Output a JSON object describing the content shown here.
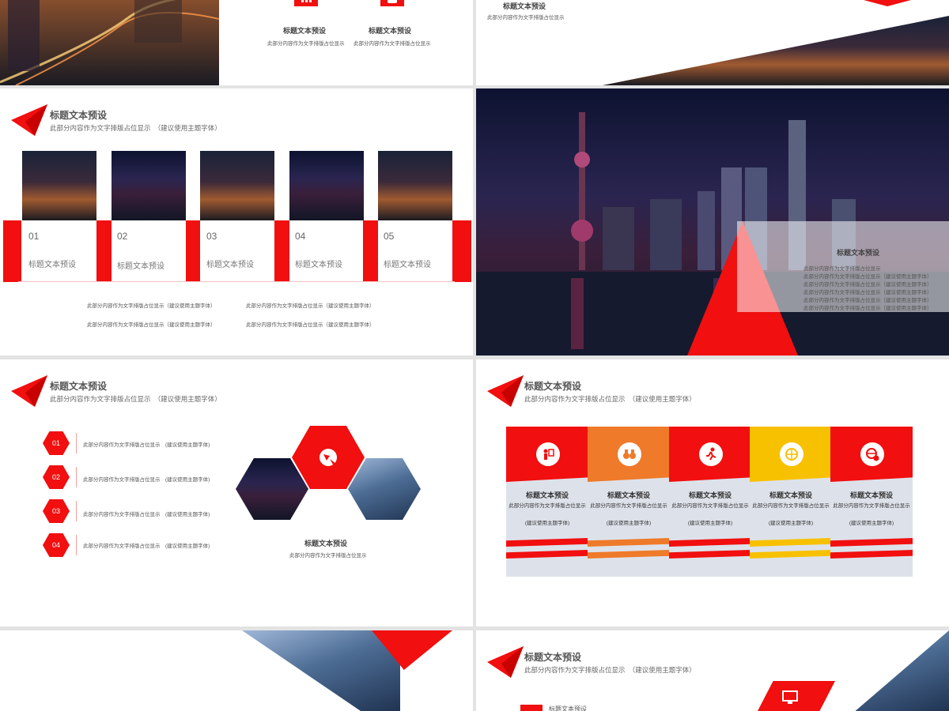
{
  "colors": {
    "accent": "#f10f0f",
    "orange": "#ee7a2a",
    "yellow": "#f8c100",
    "panel": "#dde2ea"
  },
  "top_left": {
    "items": [
      {
        "icon": "chart-icon",
        "title": "标题文本预设",
        "desc": "此部分内容作为文字排版占位显示"
      },
      {
        "icon": "user-icon",
        "title": "标题文本预设",
        "desc": "此部分内容作为文字排版占位显示"
      }
    ]
  },
  "top_right": {
    "title": "标题文本预设",
    "desc": "此部分内容作为文字排版占位显示"
  },
  "slide_cards": {
    "title": "标题文本预设",
    "subtitle": "此部分内容作为文字排版占位显示　（建议使用主题字体）",
    "cards": [
      {
        "num": "01",
        "label": "标题文本预设"
      },
      {
        "num": "02",
        "label": "标题文本预设"
      },
      {
        "num": "03",
        "label": "标题文本预设"
      },
      {
        "num": "04",
        "label": "标题文本预设"
      },
      {
        "num": "05",
        "label": "标题文本预设"
      }
    ],
    "notes": [
      "此部分内容作为文字排版占位显示（建议使用主题字体）",
      "此部分内容作为文字排版占位显示（建议使用主题字体）",
      "此部分内容作为文字排版占位显示（建议使用主题字体）",
      "此部分内容作为文字排版占位显示（建议使用主题字体）"
    ]
  },
  "slide_night": {
    "title": "标题文本预设",
    "lines": [
      "此部分内容作为文字排版占位显示",
      "此部分内容作为文字排版占位显示（建议使用主题字体）",
      "此部分内容作为文字排版占位显示（建议使用主题字体）",
      "此部分内容作为文字排版占位显示（建议使用主题字体）",
      "此部分内容作为文字排版占位显示（建议使用主题字体）",
      "此部分内容作为文字排版占位显示（建议使用主题字体）"
    ]
  },
  "slide_hex": {
    "title": "标题文本预设",
    "subtitle": "此部分内容作为文字排版占位显示　（建议使用主题字体）",
    "items": [
      {
        "num": "01",
        "text": "此部分内容作为文字排版占位显示　(建议使用主题字体)"
      },
      {
        "num": "02",
        "text": "此部分内容作为文字排版占位显示　(建议使用主题字体)"
      },
      {
        "num": "03",
        "text": "此部分内容作为文字排版占位显示　(建议使用主题字体)"
      },
      {
        "num": "04",
        "text": "此部分内容作为文字排版占位显示　(建议使用主题字体)"
      }
    ],
    "caption_title": "标题文本预设",
    "caption_desc": "此部分内容作为文字排版占位显示"
  },
  "slide_cols": {
    "title": "标题文本预设",
    "subtitle": "此部分内容作为文字排版占位显示　（建议使用主题字体）",
    "cols": [
      {
        "icon": "people-board-icon",
        "title": "标题文本预设",
        "desc": "此部分内容作为文字排版占位显示",
        "desc2": "(建议使用主题字体)",
        "color": "red"
      },
      {
        "icon": "binoculars-icon",
        "title": "标题文本预设",
        "desc": "此部分内容作为文字排版占位显示",
        "desc2": "(建议使用主题字体)",
        "color": "orange"
      },
      {
        "icon": "runner-icon",
        "title": "标题文本预设",
        "desc": "此部分内容作为文字排版占位显示",
        "desc2": "(建议使用主题字体)",
        "color": "red"
      },
      {
        "icon": "globe-money-icon",
        "title": "标题文本预设",
        "desc": "此部分内容作为文字排版占位显示",
        "desc2": "(建议使用主题字体)",
        "color": "yellow"
      },
      {
        "icon": "globe-dollar-icon",
        "title": "标题文本预设",
        "desc": "此部分内容作为文字排版占位显示",
        "desc2": "(建议使用主题字体)",
        "color": "red"
      }
    ]
  },
  "slide_bottom_right": {
    "title": "标题文本预设",
    "subtitle": "此部分内容作为文字排版占位显示　（建议使用主题字体）",
    "item": "标题文本预设"
  }
}
